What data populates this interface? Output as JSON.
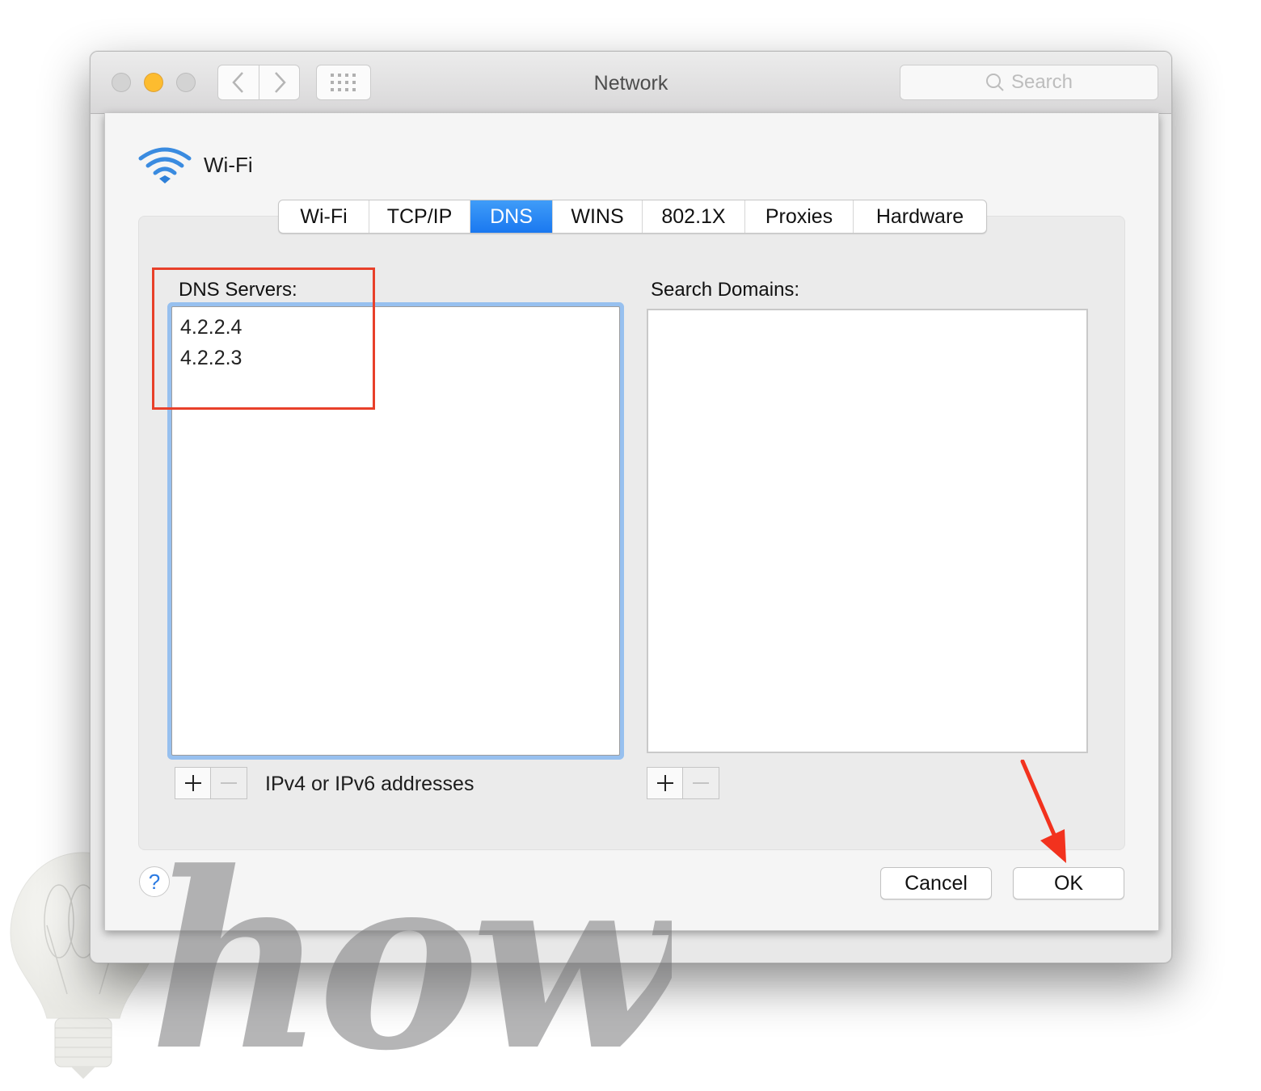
{
  "window": {
    "title": "Network",
    "search_placeholder": "Search",
    "traffic_lights": [
      "close",
      "minimize",
      "zoom"
    ],
    "nav": {
      "back_icon": "chevron-left-icon",
      "forward_icon": "chevron-right-icon",
      "grid_icon": "grid-icon"
    }
  },
  "sheet": {
    "interface_name": "Wi-Fi",
    "interface_icon": "wifi-icon",
    "tabs": [
      {
        "label": "Wi-Fi",
        "active": false
      },
      {
        "label": "TCP/IP",
        "active": false
      },
      {
        "label": "DNS",
        "active": true
      },
      {
        "label": "WINS",
        "active": false
      },
      {
        "label": "802.1X",
        "active": false
      },
      {
        "label": "Proxies",
        "active": false
      },
      {
        "label": "Hardware",
        "active": false
      }
    ],
    "dns": {
      "label": "DNS Servers:",
      "servers": [
        "4.2.2.4",
        "4.2.2.3"
      ],
      "hint": "IPv4 or IPv6 addresses"
    },
    "search_domains": {
      "label": "Search Domains:",
      "domains": []
    },
    "add_label": "+",
    "remove_label": "−",
    "help_label": "?",
    "cancel_label": "Cancel",
    "ok_label": "OK"
  },
  "annotations": {
    "highlight_color": "#e8402a",
    "arrow_color": "#f2321e"
  },
  "watermark": {
    "text": "how"
  },
  "colors": {
    "accent": "#1a78f0",
    "focus_ring": "#97c0ef",
    "minimize": "#fdbc2f",
    "help_blue": "#2a7ae2"
  }
}
